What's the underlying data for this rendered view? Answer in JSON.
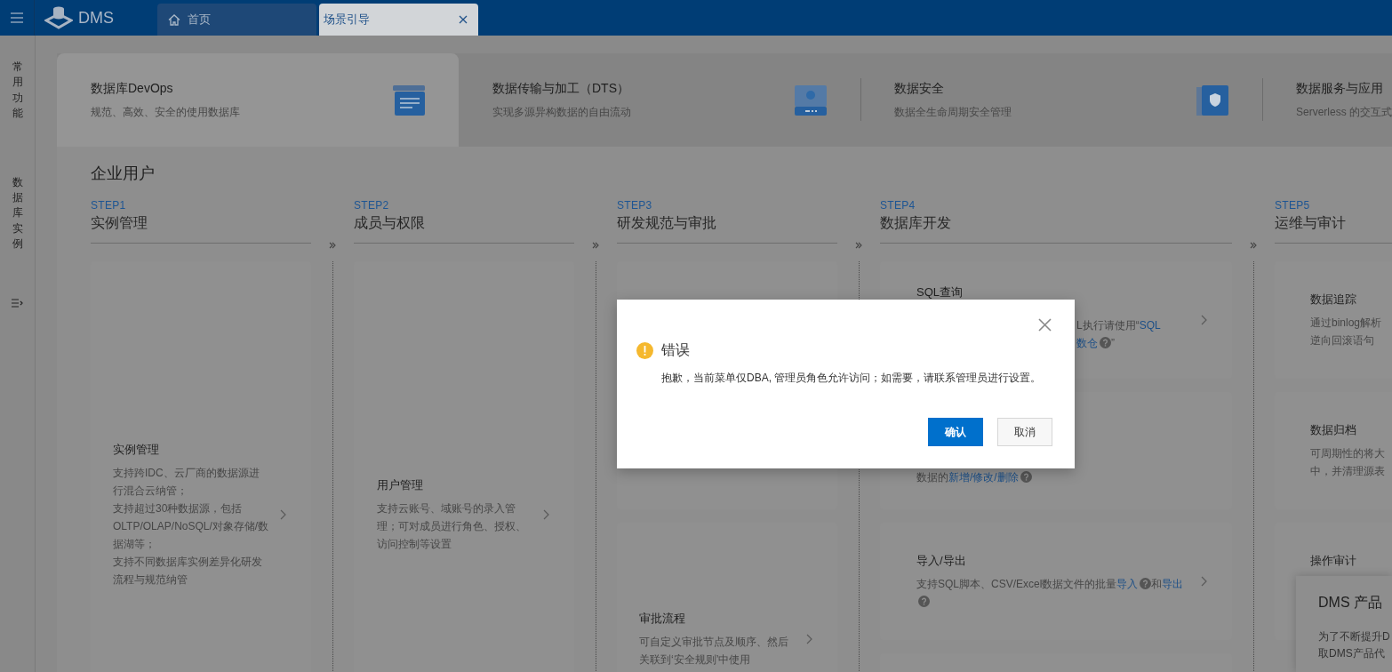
{
  "topbar": {
    "logo": "DMS",
    "tabs": [
      {
        "label": "首页",
        "kind": "home",
        "selected": false
      },
      {
        "label": "场景引导",
        "kind": "closable",
        "selected": true
      }
    ]
  },
  "sidebar": {
    "items": [
      "常用功能",
      "数据库实例"
    ]
  },
  "products": [
    {
      "title": "数据库DevOps",
      "description": "规范、高效、安全的使用数据库",
      "kind": "devops",
      "selected": true
    },
    {
      "title": "数据传输与加工（DTS）",
      "description": "实现多源异构数据的自由流动",
      "kind": "dts",
      "selected": false
    },
    {
      "title": "数据安全",
      "description": "数据全生命周期安全管理",
      "kind": "security",
      "selected": false
    },
    {
      "title": "数据服务与应用",
      "description": "Serverless 的交互式",
      "kind": "service",
      "selected": false
    }
  ],
  "section_title": "企业用户",
  "steps": [
    {
      "step": "STEP1",
      "title": "实例管理",
      "cards": [
        {
          "kind": "feature",
          "title": "实例管理",
          "lines": [
            [
              {
                "kind": "text",
                "text": "支持跨IDC、云厂商的数据源进行混合云纳管；"
              }
            ],
            [
              {
                "kind": "text",
                "text": "支持超过30种数据源，包括OLTP/OLAP/NoSQL/对象存储/数据湖等；"
              }
            ],
            [
              {
                "kind": "text",
                "text": "支持不同数据库实例差异化研发流程与规范纳管"
              }
            ]
          ]
        }
      ]
    },
    {
      "step": "STEP2",
      "title": "成员与权限",
      "cards": [
        {
          "kind": "feature",
          "title": "用户管理",
          "lines": [
            [
              {
                "kind": "text",
                "text": "支持云账号、域账号的录入管理；可对成员进行角色、授权、访问控制等设置"
              }
            ]
          ]
        }
      ]
    },
    {
      "step": "STEP3",
      "title": "研发规范与审批",
      "cards": [
        {
          "kind": "blank"
        },
        {
          "kind": "feature",
          "title": "审批流程",
          "lines": [
            [
              {
                "kind": "text",
                "text": "可自定义审批节点及顺序、然后关联到‘安全规则’中使用"
              }
            ]
          ]
        }
      ]
    },
    {
      "step": "STEP4",
      "title": "数据库开发",
      "cards": [
        {
          "kind": "covered",
          "title": "SQL查询",
          "lines": [
            [
              {
                "kind": "text",
                "text": "L执行请使用“"
              },
              {
                "kind": "link",
                "text": "SQL"
              }
            ],
            [
              {
                "kind": "link",
                "text": "数仓"
              },
              {
                "kind": "help"
              },
              {
                "kind": "text",
                "text": "”"
              }
            ]
          ]
        },
        {
          "kind": "tail",
          "lines": [
            [
              {
                "kind": "text",
                "text": "数据的"
              },
              {
                "kind": "link",
                "text": "新增/修改/删除"
              },
              {
                "kind": "help"
              }
            ]
          ]
        },
        {
          "kind": "feature",
          "title": "导入/导出",
          "lines": [
            [
              {
                "kind": "text",
                "text": "支持SQL脚本、CSV/Excel数据文件的批量"
              },
              {
                "kind": "link",
                "text": "导入"
              },
              {
                "kind": "help"
              },
              {
                "kind": "text",
                "text": "和"
              },
              {
                "kind": "link",
                "text": "导出"
              },
              {
                "kind": "help"
              }
            ]
          ]
        },
        {
          "kind": "blank"
        }
      ]
    },
    {
      "step": "STEP5",
      "title": "运维与审计",
      "cards": [
        {
          "kind": "edge",
          "title": "数据追踪",
          "lines": [
            [
              {
                "kind": "text",
                "text": "通过binlog解析"
              }
            ],
            [
              {
                "kind": "text",
                "text": "逆向回滚语句"
              }
            ]
          ]
        },
        {
          "kind": "edge",
          "title": "数据归档",
          "lines": [
            [
              {
                "kind": "text",
                "text": "可周期性的将大"
              }
            ],
            [
              {
                "kind": "text",
                "text": "中，并清理源表"
              }
            ]
          ]
        },
        {
          "kind": "edge",
          "title": "操作审计"
        }
      ]
    }
  ],
  "dialog": {
    "title": "错误",
    "message": "抱歉，当前菜单仅DBA, 管理员角色允许访问；如需要，请联系管理员进行设置。",
    "buttons": [
      {
        "label": "确认",
        "kind": "primary"
      },
      {
        "label": "取消",
        "kind": "secondary"
      }
    ]
  },
  "notice": {
    "title": "DMS 产品",
    "lines": [
      "为了不断提升D",
      "取DMS产品代"
    ]
  }
}
